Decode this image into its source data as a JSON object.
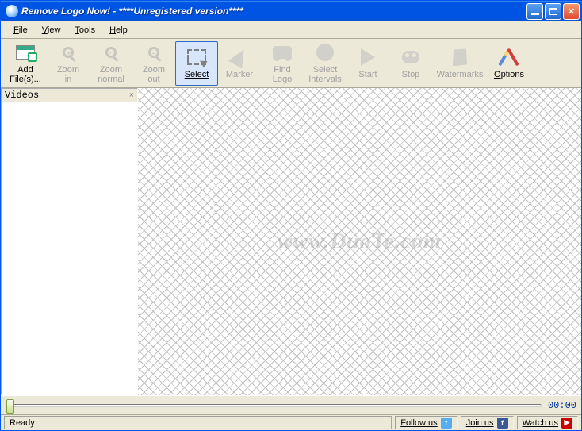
{
  "titlebar": {
    "title": "Remove Logo Now! - ****Unregistered version****"
  },
  "menu": {
    "file": "File",
    "view": "View",
    "tools": "Tools",
    "help": "Help"
  },
  "toolbar": {
    "add": "Add\nFile(s)...",
    "zoom_in": "Zoom\nin",
    "zoom_normal": "Zoom\nnormal",
    "zoom_out": "Zoom\nout",
    "select": "Select",
    "marker": "Marker",
    "find_logo": "Find\nLogo",
    "select_intervals": "Select\nIntervals",
    "start": "Start",
    "stop": "Stop",
    "watermarks": "Watermarks",
    "options": "Options"
  },
  "side": {
    "title": "Videos",
    "close": "×"
  },
  "canvas": {
    "watermark": "www.DuoTe.com"
  },
  "slider": {
    "time": "00:00"
  },
  "status": {
    "ready": "Ready",
    "follow": "Follow us",
    "join": "Join us",
    "watch": "Watch us"
  }
}
